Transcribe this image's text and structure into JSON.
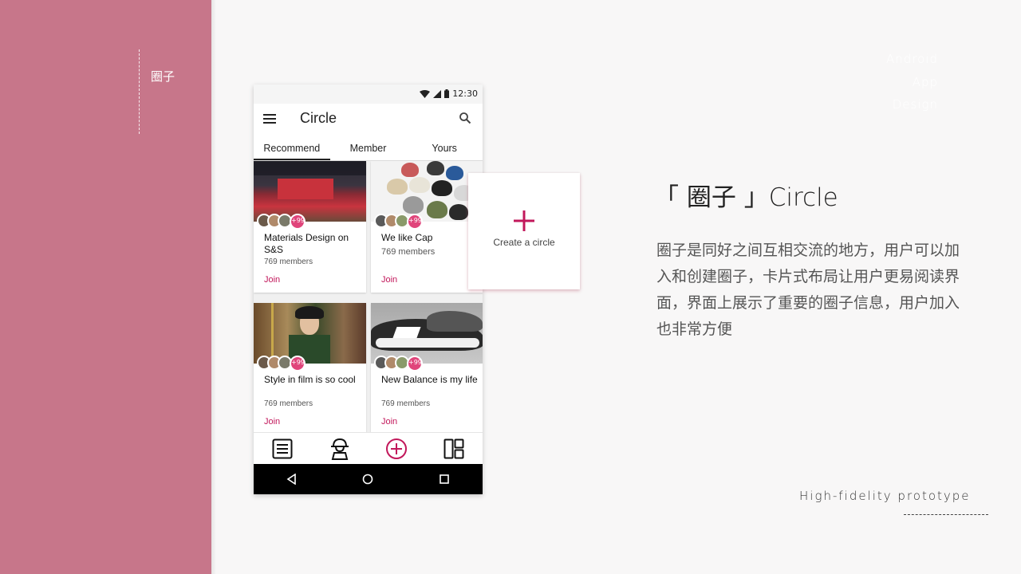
{
  "sidebar": {
    "brand_line1": "Android",
    "brand_line2": "App",
    "brand_line3": "Design",
    "brand_cn": "圈子",
    "color": "#c7768a"
  },
  "phone": {
    "status_time": "12:30",
    "app_title": "Circle",
    "tabs": [
      {
        "label": "Recommend",
        "active": true
      },
      {
        "label": "Member",
        "active": false
      },
      {
        "label": "Yours",
        "active": false
      }
    ],
    "cards": [
      {
        "name": "Materials Design on S&S",
        "members": "769 members",
        "join": "Join",
        "more": "+99",
        "image": "runway-show-photo"
      },
      {
        "name": "We like Cap",
        "members": "769 members",
        "join": "Join",
        "more": "+99",
        "image": "caps-photo"
      },
      {
        "name": "Style in film is so cool",
        "members": "769 members",
        "join": "Join",
        "more": "+99",
        "image": "film-character-photo"
      },
      {
        "name": "New Balance is my life",
        "members": "769 members",
        "join": "Join",
        "more": "+99",
        "image": "sneakers-photo"
      }
    ],
    "bottom_nav": [
      "list-icon",
      "user-icon",
      "add-circle-icon",
      "dashboard-icon"
    ],
    "system_nav": [
      "back-icon",
      "home-icon",
      "recents-icon"
    ]
  },
  "create_card": {
    "label": "Create a circle",
    "accent": "#c2185b"
  },
  "headline": "「 圈子 」Circle",
  "description": "圈子是同好之间互相交流的地方，用户可以加入和创建圈子，卡片式布局让用户更易阅读界面，界面上展示了重要的圈子信息，用户加入也非常方便",
  "footer": "High-fidelity prototype"
}
